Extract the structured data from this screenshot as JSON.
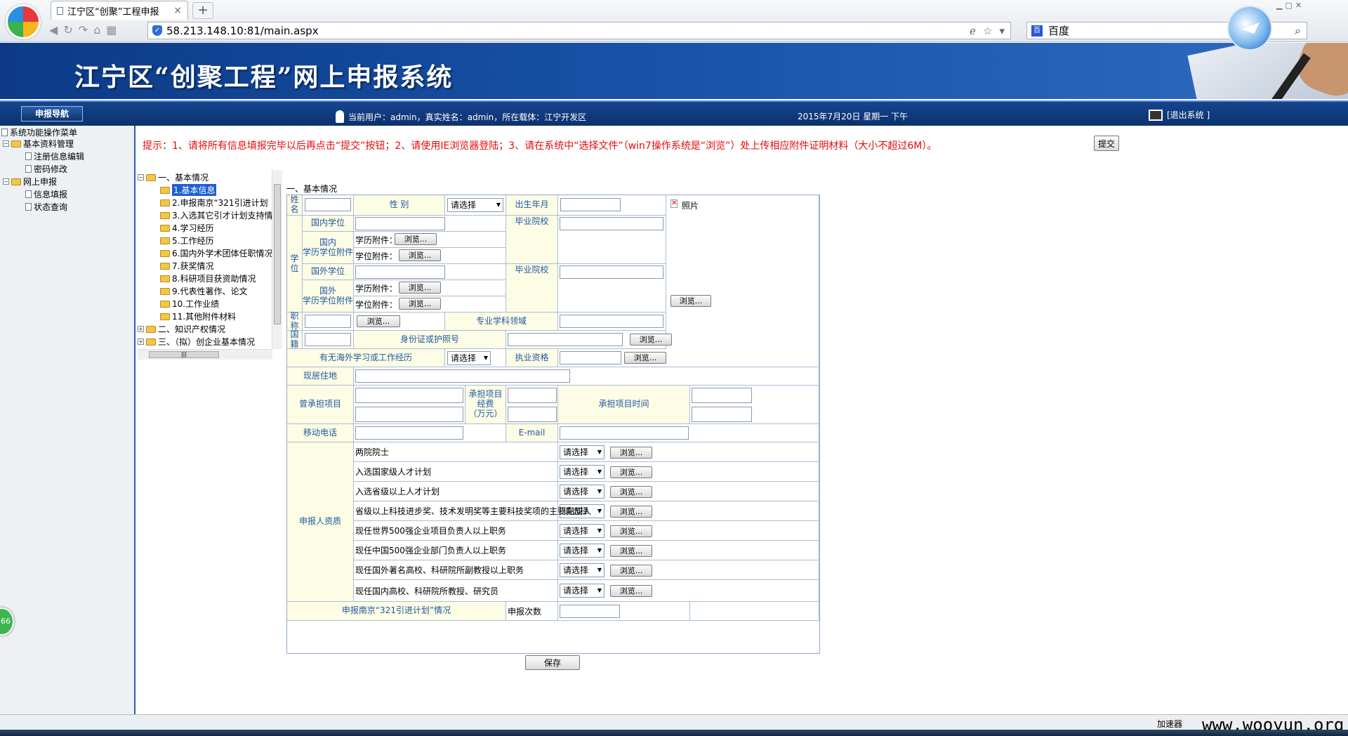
{
  "browser": {
    "tab_title": "江宁区“创聚”工程申报",
    "tab_close": "×",
    "new_tab": "+",
    "url": "58.213.148.10:81/main.aspx",
    "search_engine": "百度",
    "nav_icons": [
      "back-icon",
      "refresh-icon",
      "forward-icon",
      "home-icon",
      "grid-icon"
    ]
  },
  "banner": {
    "title": "江宁区“创聚工程”网上申报系统"
  },
  "infobar": {
    "nav_tab": "申报导航",
    "user_info": "当前用户：admin，真实姓名：admin，所在载体：江宁开发区",
    "date": "2015年7月20日 星期一 下午",
    "logout": "[退出系统 ]"
  },
  "sidebar": {
    "root": "系统功能操作菜单",
    "groups": [
      {
        "label": "基本资料管理",
        "items": [
          "注册信息编辑",
          "密码修改"
        ]
      },
      {
        "label": "网上申报",
        "items": [
          "信息填报",
          "状态查询"
        ]
      }
    ],
    "badge": "66"
  },
  "tip": "提示：1、请将所有信息填报完毕以后再点击“提交”按钮；2、请使用IE浏览器登陆；3、请在系统中“选择文件”（win7操作系统是“浏览”）处上传相应附件证明材料（大小不超过6M）。",
  "submit_label": "提交",
  "tree": {
    "sections": [
      {
        "label": "一、基本情况",
        "items": [
          "1.基本信息",
          "2.申报南京“321引进计划",
          "3.入选其它引才计划支持情",
          "4.学习经历",
          "5.工作经历",
          "6.国内外学术团体任职情况",
          "7.获奖情况",
          "8.科研项目获资助情况",
          "9.代表性著作、论文",
          "10.工作业绩",
          "11.其他附件材料"
        ]
      },
      {
        "label": "二、知识产权情况"
      },
      {
        "label": "三、（拟）创企业基本情况"
      }
    ]
  },
  "form": {
    "section_title": "一、基本情况",
    "name": "姓名",
    "gender": "性 别",
    "please_select": "请选择",
    "birth": "出生年月",
    "photo": "照片",
    "degree": "学位",
    "domestic_degree": "国内学位",
    "grad_school": "毕业院校",
    "domestic_attach": "国内\n学历学位附件",
    "edu_attach": "学历附件：",
    "deg_attach": "学位附件：",
    "browse": "浏览...",
    "foreign_degree": "国外学位",
    "foreign_attach": "国外\n学历学位附件",
    "title": "职称",
    "specialty": "专业学科领域",
    "nationality": "国籍",
    "id_card": "身份证或护照号",
    "overseas": "有无海外学习或工作经历",
    "license": "执业资格",
    "address": "现居住地",
    "projects": "曾承担项目",
    "project_fund": "承担项目经费\n（万元）",
    "project_time": "承担项目时间",
    "mobile": "移动电话",
    "email": "E-mail",
    "qualification": "申报人资质",
    "quals": [
      "两院院士",
      "入选国家级人才计划",
      "入选省级以上人才计划",
      "省级以上科技进步奖、技术发明奖等主要科技奖项的主要完成人",
      "现任世界500强企业项目负责人以上职务",
      "现任中国500强企业部门负责人以上职务",
      "现任国外著名高校、科研院所副教授以上职务",
      "现任国内高校、科研院所教授、研究员"
    ],
    "plan321": "申报南京“321引进计划”情况",
    "apply_count": "申报次数",
    "save": "保存"
  },
  "status": {
    "accelerator": "加速器",
    "watermark": "www.wooyun.org"
  }
}
